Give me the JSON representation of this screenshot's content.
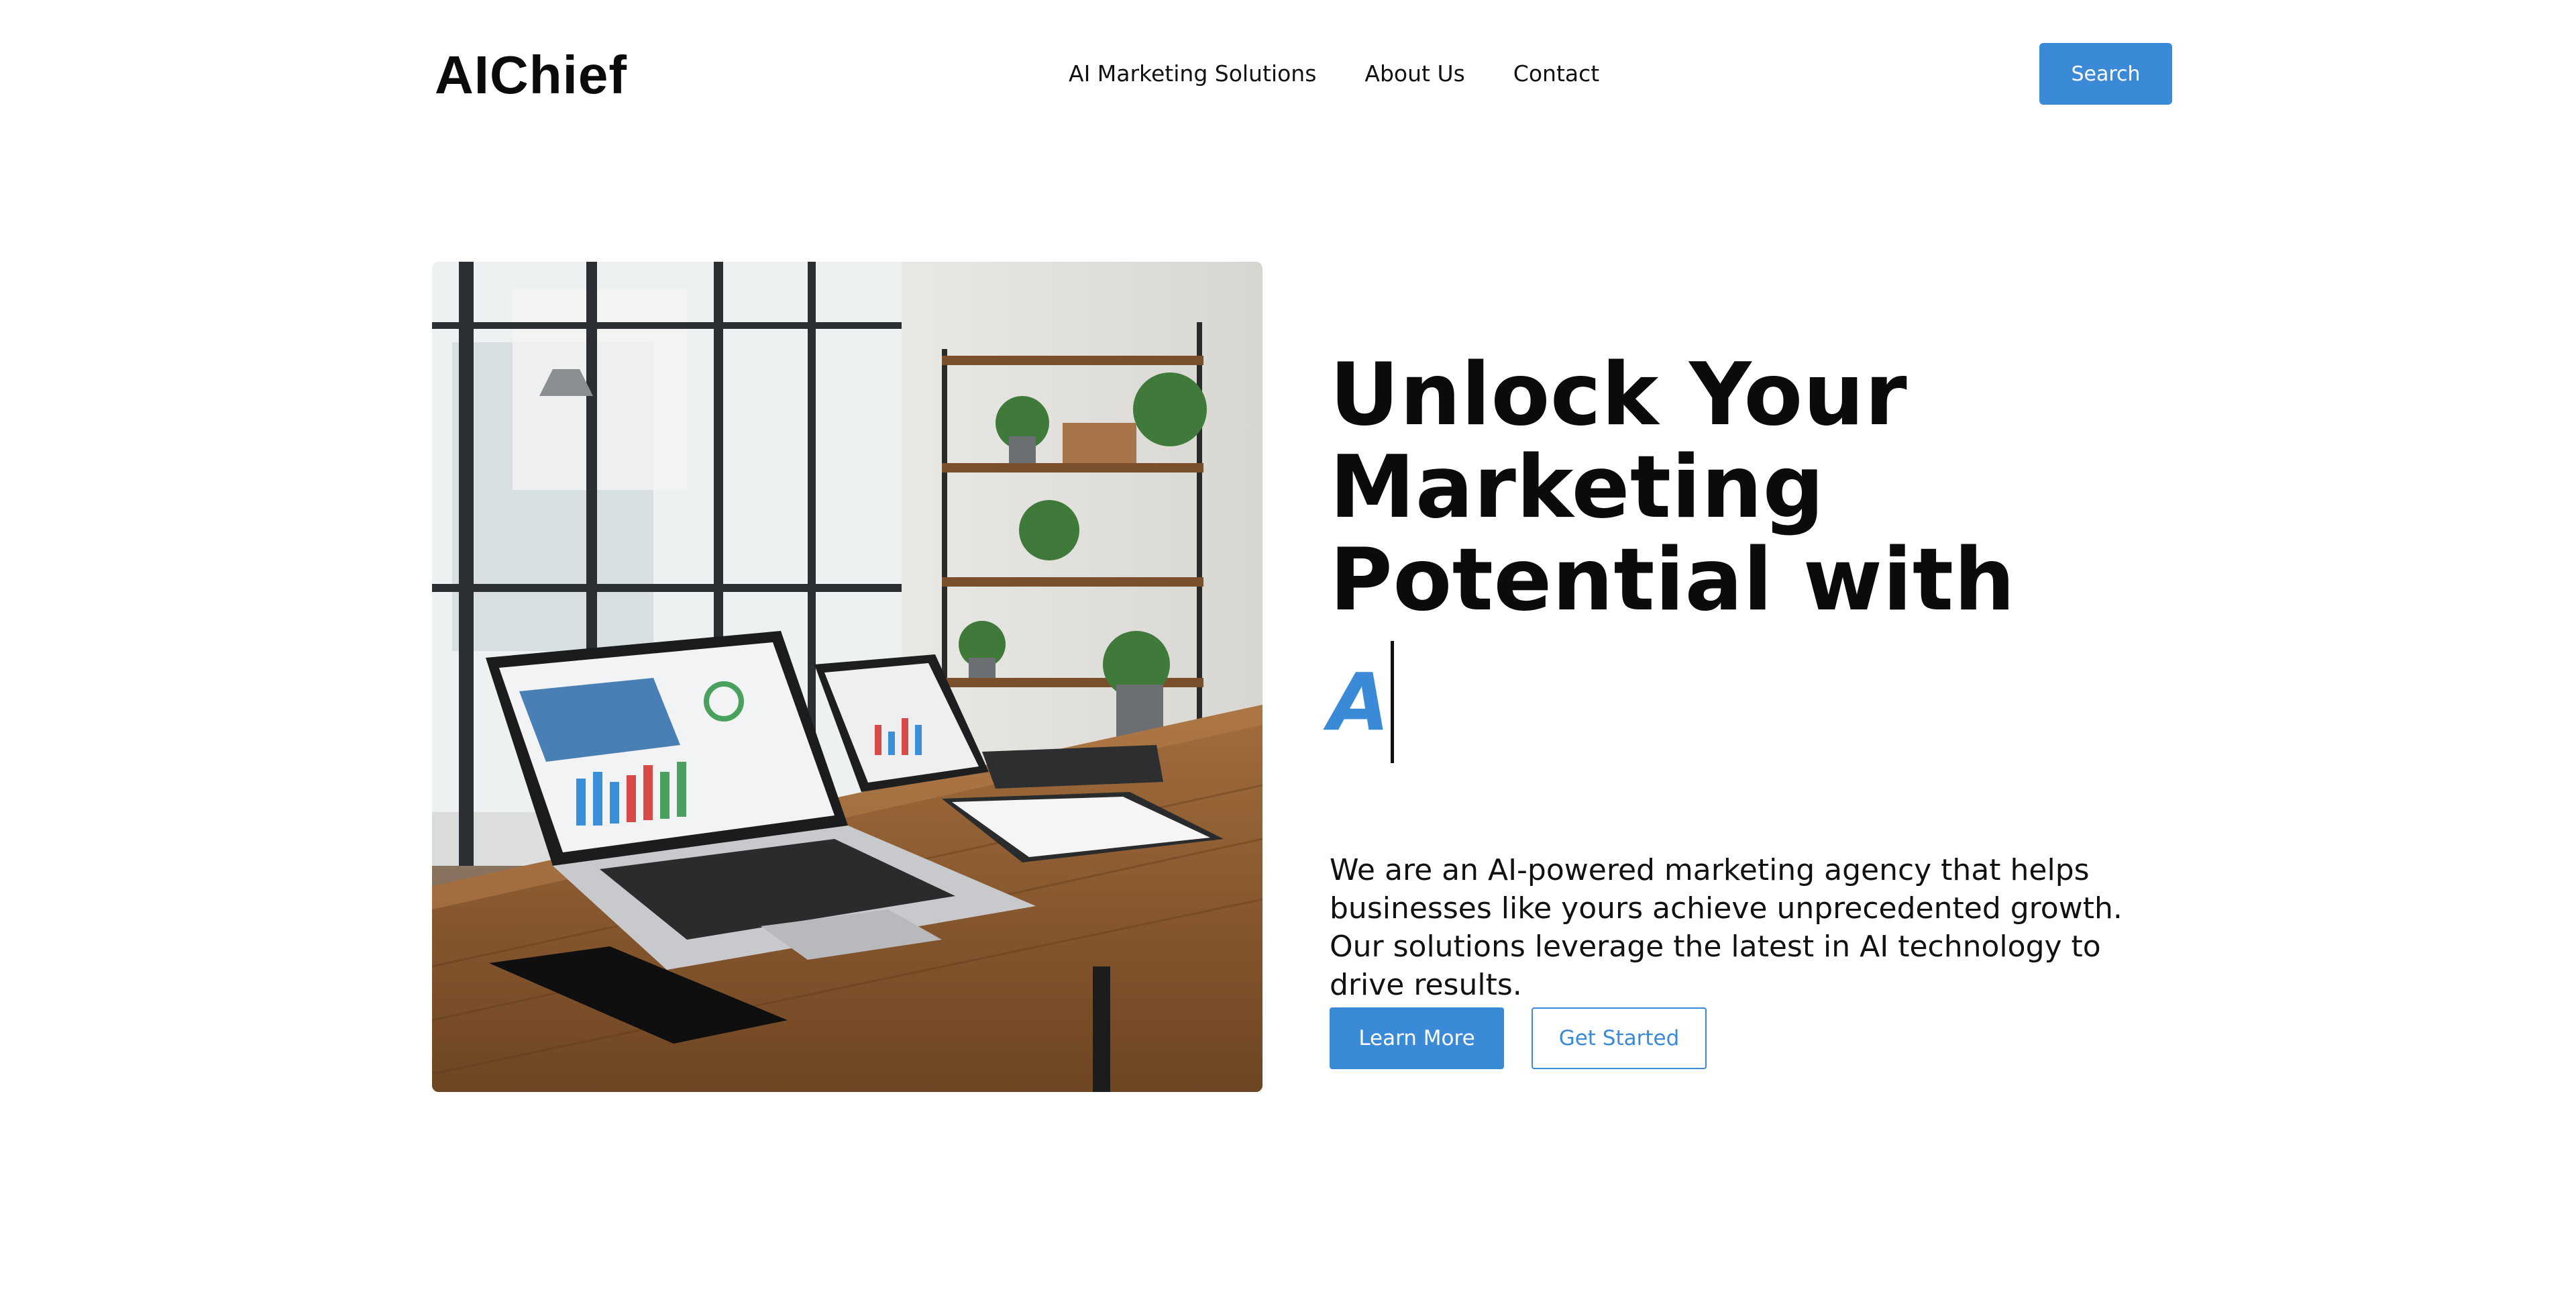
{
  "header": {
    "logo": "AIChief",
    "nav": [
      {
        "label": "AI Marketing Solutions"
      },
      {
        "label": "About Us"
      },
      {
        "label": "Contact"
      }
    ],
    "search_label": "Search"
  },
  "hero": {
    "headline": "Unlock Your Marketing Potential with",
    "typed_text": "A",
    "description": "We are an AI-powered marketing agency that helps businesses like yours achieve unprecedented growth. Our solutions leverage the latest in AI technology to drive results.",
    "primary_button": "Learn More",
    "secondary_button": "Get Started"
  },
  "colors": {
    "accent": "#3b8ad8",
    "text": "#111111",
    "background": "#ffffff"
  }
}
